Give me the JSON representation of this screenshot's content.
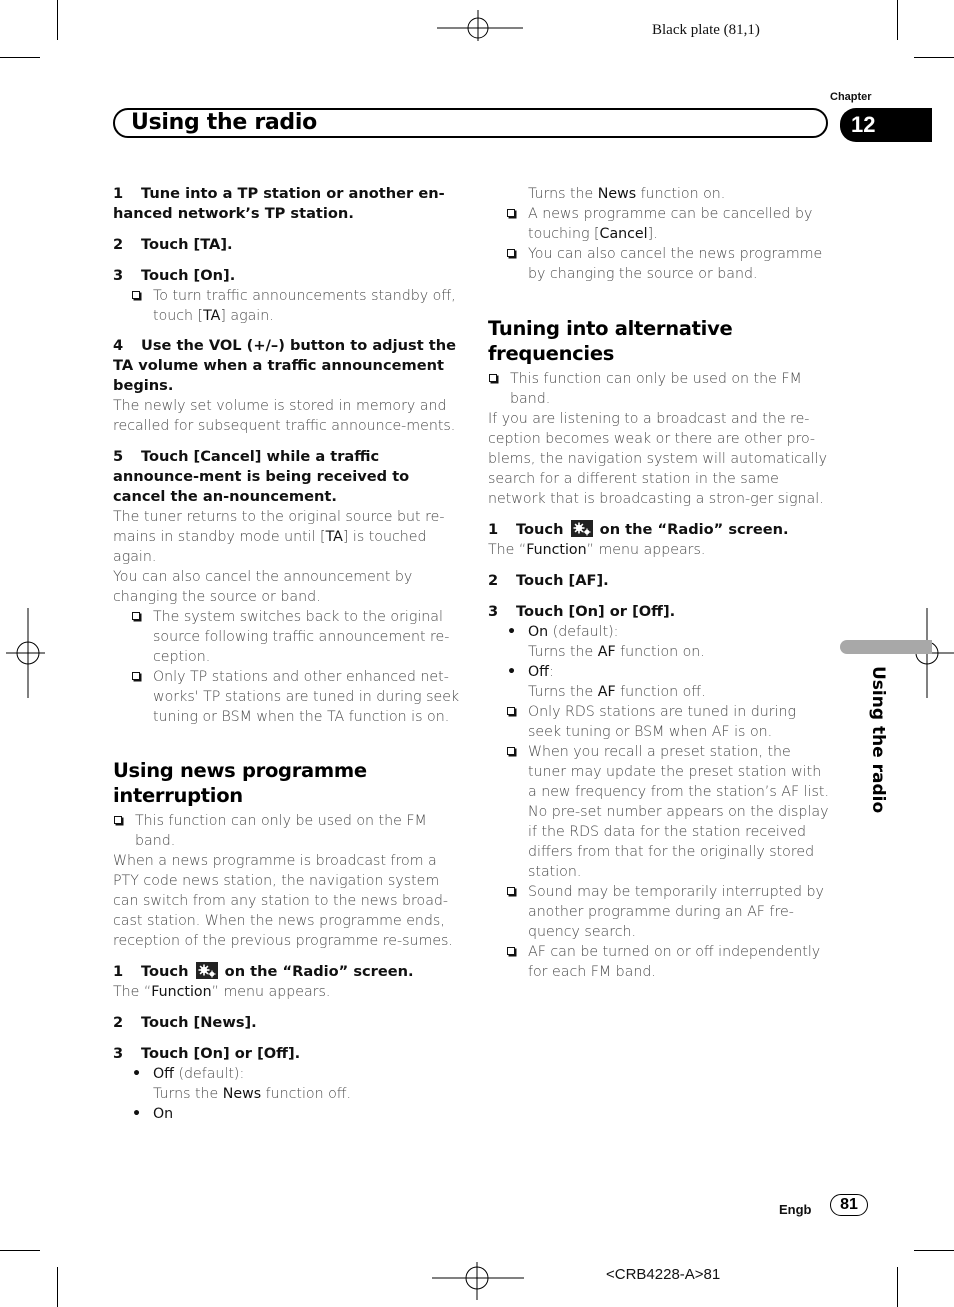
{
  "header": {
    "plate": "Black plate (81,1)",
    "chapter_label": "Chapter",
    "chapter_number": "12",
    "title": "Using the radio"
  },
  "left": {
    "steps_ta": [
      {
        "num": "1",
        "text": "Tune into a TP station or another en-hanced network’s TP station."
      },
      {
        "num": "2",
        "text": "Touch [TA]."
      },
      {
        "num": "3",
        "text": "Touch [On]."
      }
    ],
    "note_ta_off_pre": "To turn traffic announcements standby off, touch [",
    "note_ta_off_bold": "TA",
    "note_ta_off_post": "] again.",
    "step4_num": "4",
    "step4_text": "Use the VOL (+/–) button to adjust the TA volume when a traffic announcement begins.",
    "step4_desc": "The newly set volume is stored in memory and recalled for subsequent traffic announce-ments.",
    "step5_num": "5",
    "step5_text": "Touch [Cancel] while a traffic announce-ment is being received to cancel the an-nouncement.",
    "step5_desc_pre": "The tuner returns to the original source but re-mains in standby mode until [",
    "step5_desc_bold": "TA",
    "step5_desc_post": "] is touched again.",
    "step5_desc2": "You can also cancel the announcement by changing the source or band.",
    "step5_notes": [
      "The system switches back to the original source following traffic announcement re-ception.",
      "Only TP stations and other enhanced net-works' TP stations are tuned in during seek tuning or BSM when the TA function is on."
    ],
    "news_heading": "Using news programme interruption",
    "news_note": "This function can only be used on the FM band.",
    "news_desc": "When a news programme is broadcast from a PTY code news station, the navigation system can switch from any station to the news broad-cast station. When the news programme ends, reception of the previous programme re-sumes.",
    "news_step1_num": "1",
    "news_step1_pre": "Touch",
    "news_step1_post": "on the “Radio” screen.",
    "news_step1_desc_pre": "The “",
    "news_step1_desc_bold": "Function",
    "news_step1_desc_post": "” menu appears.",
    "news_step2_num": "2",
    "news_step2_text": "Touch [News].",
    "news_step3_num": "3",
    "news_step3_text": "Touch [On] or [Off].",
    "news_off_bold": "Off",
    "news_off_rest": " (default):",
    "news_off_desc_pre": "Turns the ",
    "news_off_desc_bold": "News",
    "news_off_desc_post": " function off.",
    "news_on_bold": "On"
  },
  "right": {
    "news_on_desc_pre": "Turns the ",
    "news_on_desc_bold": "News",
    "news_on_desc_post": " function on.",
    "news_cancel_pre": "A news programme can be cancelled by touching [",
    "news_cancel_bold": "Cancel",
    "news_cancel_post": "].",
    "news_cancel2": "You can also cancel the news programme by changing the source or band.",
    "af_heading": "Tuning into alternative frequencies",
    "af_note": "This function can only be used on the FM band.",
    "af_desc": "If you are listening to a broadcast and the re-ception becomes weak or there are other pro-blems, the navigation system will automatically search for a different station in the same network that is broadcasting a stron-ger signal.",
    "af_step1_num": "1",
    "af_step1_pre": "Touch",
    "af_step1_post": "on the “Radio” screen.",
    "af_step1_desc_pre": "The “",
    "af_step1_desc_bold": "Function",
    "af_step1_desc_post": "” menu appears.",
    "af_step2_num": "2",
    "af_step2_text": "Touch [AF].",
    "af_step3_num": "3",
    "af_step3_text": "Touch [On] or [Off].",
    "af_on_bold": "On",
    "af_on_rest": " (default):",
    "af_on_desc_pre": "Turns the ",
    "af_on_desc_bold": "AF",
    "af_on_desc_post": " function on.",
    "af_off_bold": "Off",
    "af_off_rest": ":",
    "af_off_desc_pre": "Turns the ",
    "af_off_desc_bold": "AF",
    "af_off_desc_post": " function off.",
    "af_notes": [
      "Only RDS stations are tuned in during seek tuning or BSM when AF is on.",
      "When you recall a preset station, the tuner may update the preset station with a new frequency from the station’s AF list. No pre-set number appears on the display if the RDS data for the station received differs from that for the originally stored station.",
      "Sound may be temporarily interrupted by another programme during an AF fre-quency search.",
      "AF can be turned on or off independently for each FM band."
    ]
  },
  "side_tab": {
    "label": "Using the radio"
  },
  "footer": {
    "language": "Engb",
    "page_number": "81",
    "code": "<CRB4228-A>81"
  },
  "icons": {
    "function_icon": "gear-cluster-icon"
  }
}
